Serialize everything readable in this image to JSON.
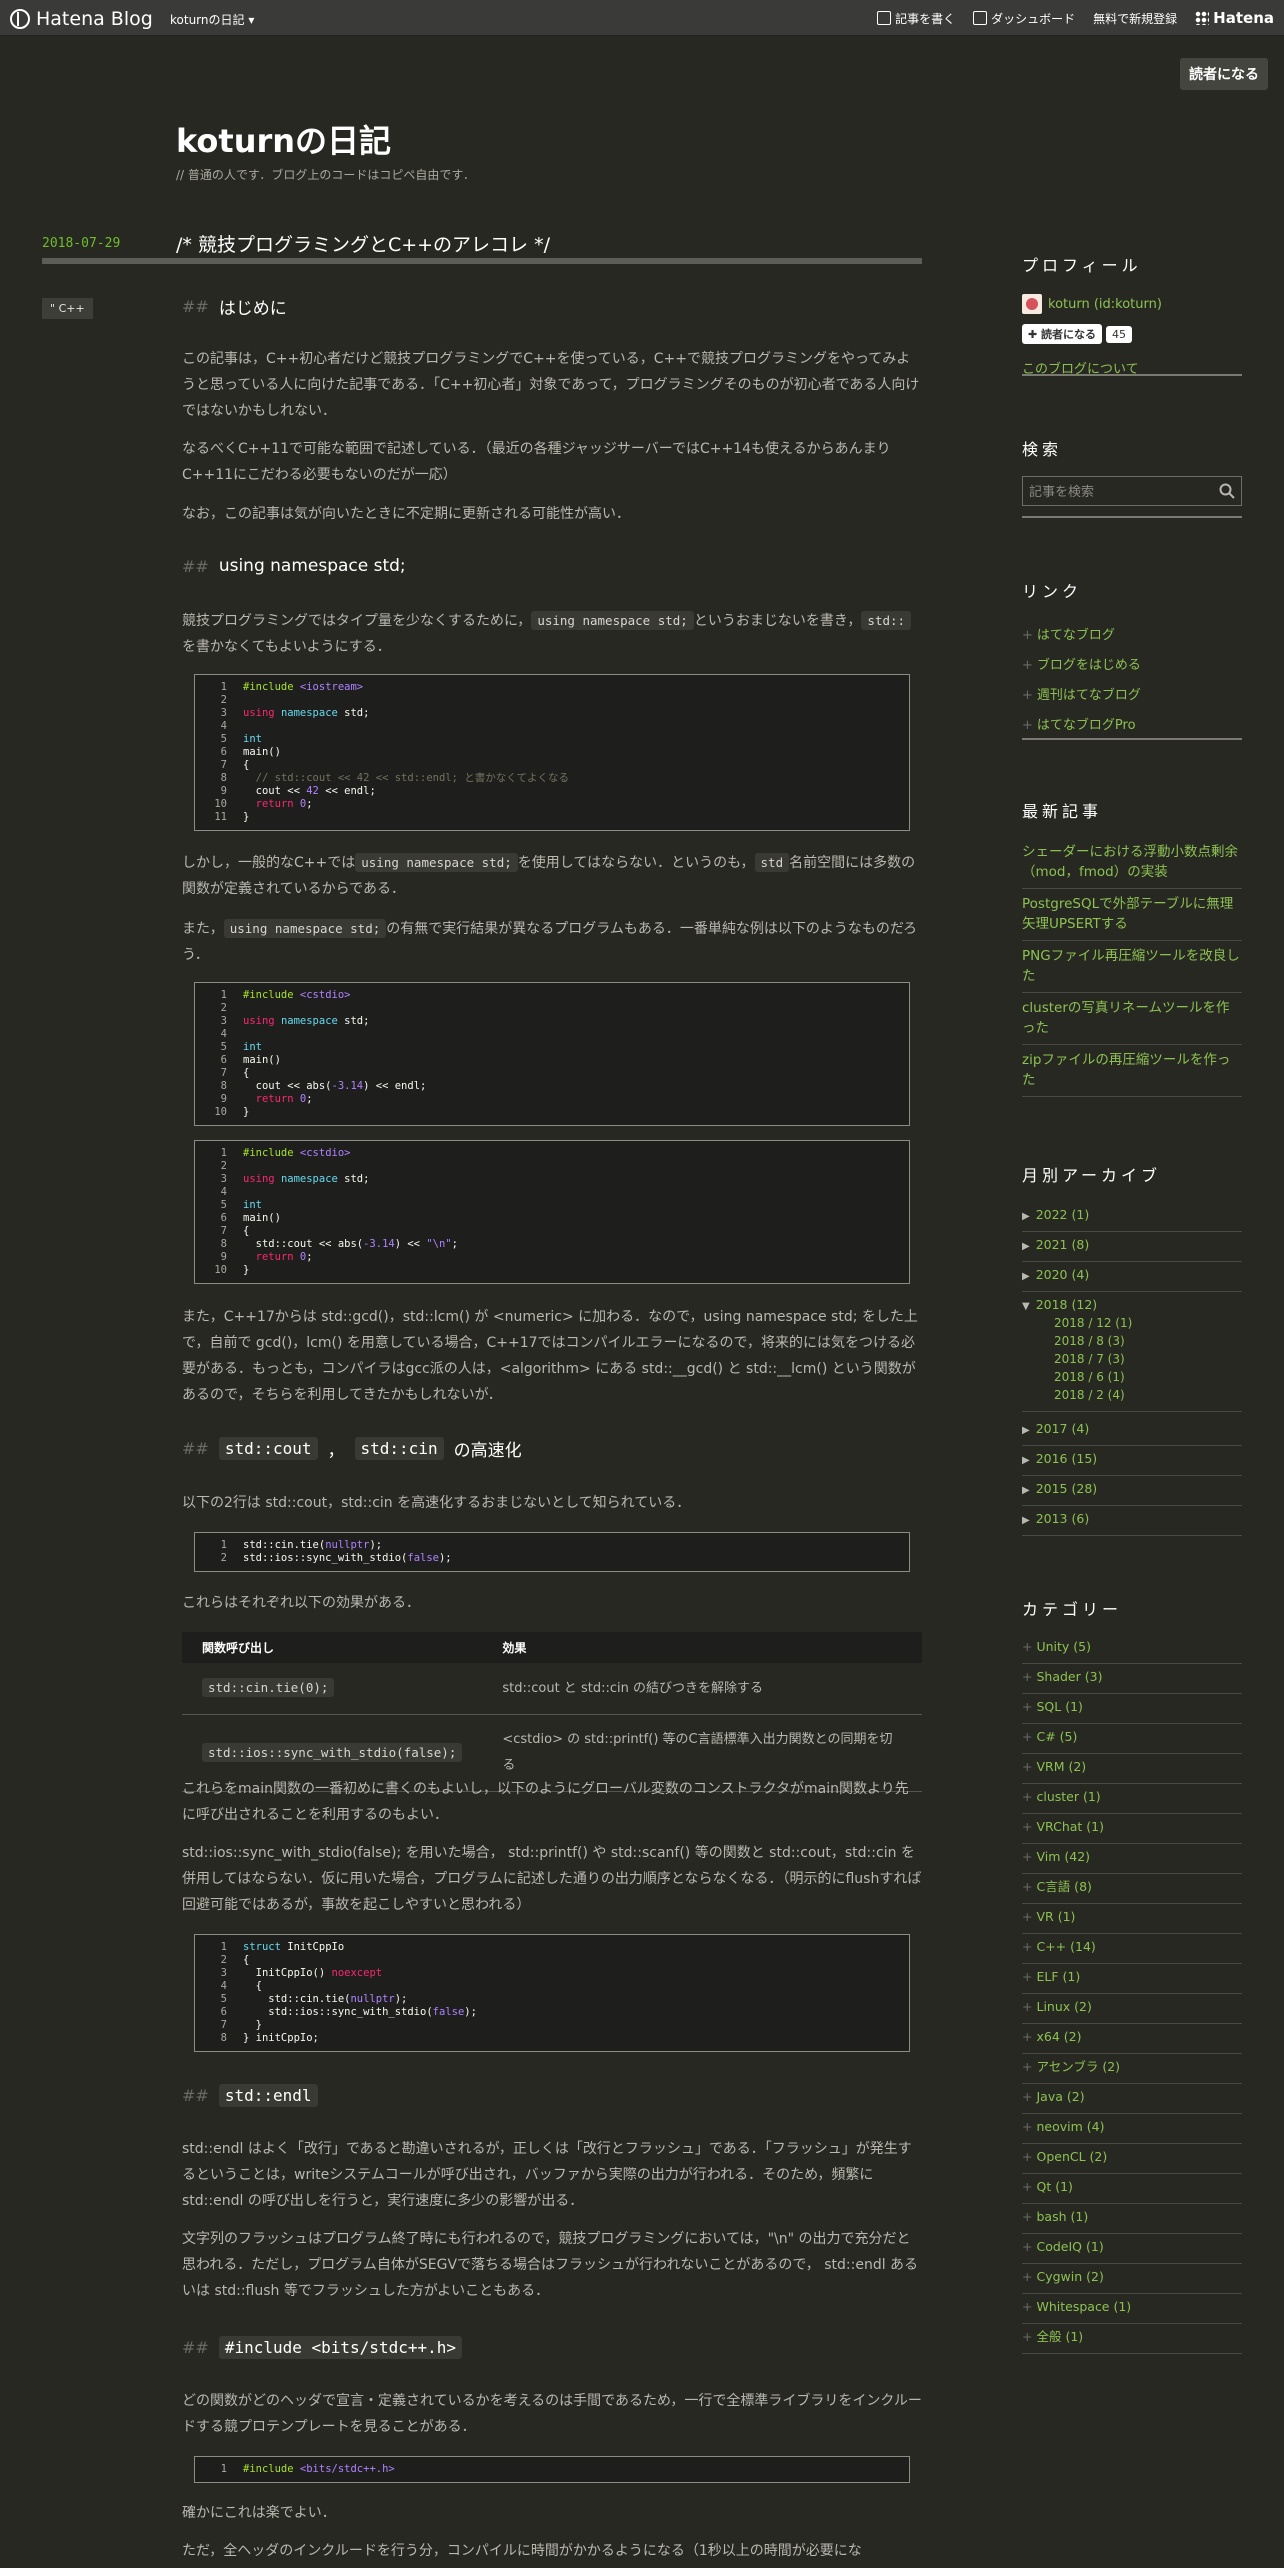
{
  "topbar": {
    "logo": "Hatena Blog",
    "blog_menu": "koturnの日記",
    "write": "記事を書く",
    "dashboard": "ダッシュボード",
    "signup": "無料で新規登録",
    "hatena": "Hatena"
  },
  "subscribe_top": "読者になる",
  "blog": {
    "title": "koturnの日記",
    "description": "普通の人です．ブログ上のコードはコピペ自由です．"
  },
  "post": {
    "date": "2018-07-29",
    "title": "/*  競技プログラミングとC++のアレコレ  */",
    "category": "C++"
  },
  "sections": {
    "intro_h": "はじめに",
    "intro_p1": "この記事は，C++初心者だけど競技プログラミングでC++を使っている，C++で競技プログラミングをやってみようと思っている人に向けた記事である．「C++初心者」対象であって，プログラミングそのものが初心者である人向けではないかもしれない．",
    "intro_p2": "なるべくC++11で可能な範囲で記述している．（最近の各種ジャッジサーバーではC++14も使えるからあんまりC++11にこだわる必要もないのだが一応）",
    "intro_p3": "なお，この記事は気が向いたときに不定期に更新される可能性が高い．",
    "ns_h": "using namespace std;",
    "ns_p1a": "競技プログラミングではタイプ量を少なくするために，",
    "ns_p1b": "using namespace std;",
    "ns_p1c": "というおまじないを書き，",
    "ns_p1d": "std::",
    "ns_p1e": "を書かなくてもよいようにする．",
    "ns_p2a": "しかし，一般的なC++では",
    "ns_p2b": "using namespace std;",
    "ns_p2c": "を使用してはならない．というのも，",
    "ns_p2d": "std",
    "ns_p2e": "名前空間には多数の関数が定義されているからである．",
    "ns_p3a": "また，",
    "ns_p3b": "using namespace std;",
    "ns_p3c": "の有無で実行結果が異なるプログラムもある．一番単純な例は以下のようなものだろう．",
    "ns_p4": "また，C++17からは std::gcd()，std::lcm() が <numeric> に加わる．なので，using namespace std; をした上で，自前で gcd()，lcm() を用意している場合，C++17ではコンパイルエラーになるので，将来的には気をつける必要がある．もっとも，コンパイラはgcc派の人は，<algorithm> にある std::__gcd() と std::__lcm() という関数があるので，そちらを利用してきたかもしれないが．",
    "cout_h1": "std::cout",
    "cout_h2": "，",
    "cout_h3": "std::cin",
    "cout_h4": "の高速化",
    "cout_p1": "以下の2行は std::cout，std::cin を高速化するおまじないとして知られている．",
    "cout_p2": "これらはそれぞれ以下の効果がある．",
    "cout_p3": "これらをmain関数の一番初めに書くのもよいし，以下のようにグローバル変数のコンストラクタがmain関数より先に呼び出されることを利用するのもよい．",
    "cout_p4": "std::ios::sync_with_stdio(false); を用いた場合， std::printf() や std::scanf() 等の関数と std::cout，std::cin を併用してはならない．仮に用いた場合，プログラムに記述した通りの出力順序とならなくなる．（明示的にflushすれば回避可能ではあるが，事故を起こしやすいと思われる）",
    "endl_h": "std::endl",
    "endl_p1": "std::endl はよく「改行」であると勘違いされるが，正しくは「改行とフラッシュ」である．「フラッシュ」が発生するということは，writeシステムコールが呼び出され，バッファから実際の出力が行われる．そのため，頻繁に std::endl の呼び出しを行うと，実行速度に多少の影響が出る．",
    "endl_p2": "文字列のフラッシュはプログラム終了時にも行われるので，競技プログラミングにおいては，\"\\n\" の出力で充分だと思われる．ただし，プログラム自体がSEGVで落ちる場合はフラッシュが行われないことがあるので， std::endl あるいは std::flush 等でフラッシュした方がよいこともある．",
    "bits_h": "#include <bits/stdc++.h>",
    "bits_p1": "どの関数がどのヘッダで宣言・定義されているかを考えるのは手間であるため，一行で全標準ライブラリをインクルードする競プロテンプレートを見ることがある．",
    "bits_p2": "確かにこれは楽でよい．",
    "bits_p3": "ただ，全ヘッダのインクルードを行う分，コンパイルに時間がかかるようになる（1秒以上の時間が必要にな"
  },
  "table": {
    "headers": [
      "関数呼び出し",
      "効果"
    ],
    "rows": [
      [
        "std::cin.tie(0);",
        "std::cout と std::cin の結びつきを解除する"
      ],
      [
        "std::ios::sync_with_stdio(false);",
        "<cstdio> の std::printf() 等のC言語標準入出力関数との同期を切る"
      ]
    ]
  },
  "sidebar": {
    "profile_h": "プロフィール",
    "profile_name": "koturn (id:koturn)",
    "reader_btn": "読者になる",
    "reader_count": "45",
    "about": "このブログについて",
    "search_h": "検索",
    "search_placeholder": "記事を検索",
    "links_h": "リンク",
    "links": [
      "はてなブログ",
      "ブログをはじめる",
      "週刊はてなブログ",
      "はてなブログPro"
    ],
    "recent_h": "最新記事",
    "recent": [
      "シェーダーにおける浮動小数点剰余（mod，fmod）の実装",
      "PostgreSQLで外部テーブルに無理矢理UPSERTする",
      "PNGファイル再圧縮ツールを改良した",
      "clusterの写真リネームツールを作った",
      "zipファイルの再圧縮ツールを作った"
    ],
    "archive_h": "月別アーカイブ",
    "archive": [
      "2022 (1)",
      "2021 (8)",
      "2020 (4)",
      "2018 (12)",
      "2017 (4)",
      "2016 (15)",
      "2015 (28)",
      "2013 (6)"
    ],
    "archive_sub": [
      "2018 / 12 (1)",
      "2018 / 8 (3)",
      "2018 / 7 (3)",
      "2018 / 6 (1)",
      "2018 / 2 (4)"
    ],
    "category_h": "カテゴリー",
    "categories": [
      "Unity (5)",
      "Shader (3)",
      "SQL (1)",
      "C# (5)",
      "VRM (2)",
      "cluster (1)",
      "VRChat (1)",
      "Vim (42)",
      "C言語 (8)",
      "VR (1)",
      "C++ (14)",
      "ELF (1)",
      "Linux (2)",
      "x64 (2)",
      "アセンブラ (2)",
      "Java (2)",
      "neovim (4)",
      "OpenCL (2)",
      "Qt (1)",
      "bash (1)",
      "CodeIQ (1)",
      "Cygwin (2)",
      "Whitespace (1)",
      "全般 (1)"
    ]
  },
  "colors": {
    "background": "#272822",
    "link": "#8cc152",
    "accent_date": "#6ebd2c"
  }
}
